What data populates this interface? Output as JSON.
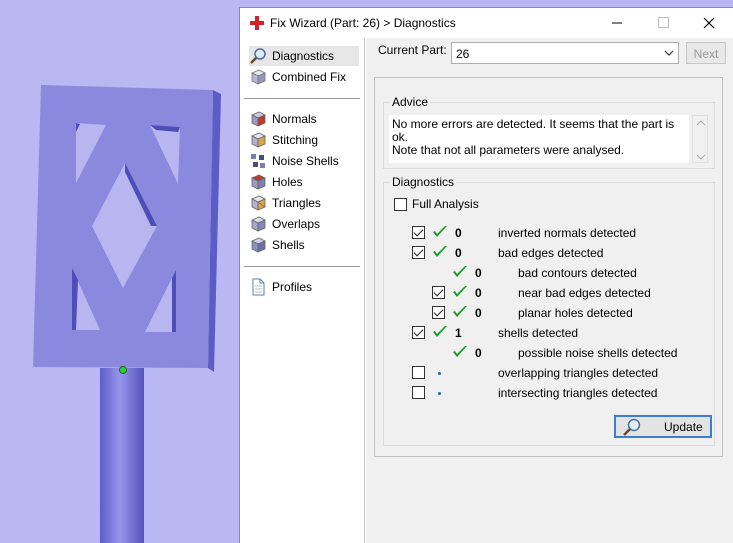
{
  "window": {
    "title": "Fix Wizard (Part: 26) > Diagnostics"
  },
  "nav": {
    "items": [
      {
        "label": "Diagnostics",
        "icon": "magnifier-icon"
      },
      {
        "label": "Combined Fix",
        "icon": "cube-icon"
      },
      {
        "label": "Normals",
        "icon": "normals-cube-icon"
      },
      {
        "label": "Stitching",
        "icon": "stitching-icon"
      },
      {
        "label": "Noise Shells",
        "icon": "noise-shells-icon"
      },
      {
        "label": "Holes",
        "icon": "holes-icon"
      },
      {
        "label": "Triangles",
        "icon": "triangles-icon"
      },
      {
        "label": "Overlaps",
        "icon": "overlaps-icon"
      },
      {
        "label": "Shells",
        "icon": "shells-icon"
      },
      {
        "label": "Profiles",
        "icon": "document-icon"
      }
    ]
  },
  "part": {
    "label": "Current Part:",
    "value": "26",
    "next_label": "Next"
  },
  "advice": {
    "title": "Advice",
    "line1": "No more errors are detected. It seems that the part is ok.",
    "line2": "Note that not all parameters were analysed."
  },
  "diagnostics": {
    "title": "Diagnostics",
    "full_analysis_label": "Full Analysis",
    "full_analysis_checked": false,
    "rows": [
      {
        "checkbox": true,
        "checked": true,
        "status": "ok",
        "count": "0",
        "label": "inverted normals detected"
      },
      {
        "checkbox": true,
        "checked": true,
        "status": "ok",
        "count": "0",
        "label": "bad edges detected"
      },
      {
        "checkbox": false,
        "checked": false,
        "status": "ok",
        "count": "0",
        "label": "bad contours detected"
      },
      {
        "checkbox": true,
        "checked": true,
        "status": "ok",
        "count": "0",
        "label": "near bad edges detected"
      },
      {
        "checkbox": true,
        "checked": true,
        "status": "ok",
        "count": "0",
        "label": "planar holes detected"
      },
      {
        "checkbox": true,
        "checked": true,
        "status": "ok",
        "count": "1",
        "label": "shells detected"
      },
      {
        "checkbox": false,
        "checked": false,
        "status": "ok",
        "count": "0",
        "label": "possible noise shells detected"
      },
      {
        "checkbox": true,
        "checked": false,
        "status": "pending",
        "count": "",
        "label": "overlapping triangles detected"
      },
      {
        "checkbox": true,
        "checked": false,
        "status": "pending",
        "count": "",
        "label": "intersecting triangles detected"
      }
    ],
    "update_label": "Update"
  },
  "colors": {
    "viewport_bg": "#b9b8f2",
    "model": "#8a89de",
    "tick_green": "#1f9a2f",
    "accent": "#3c7fd1"
  }
}
